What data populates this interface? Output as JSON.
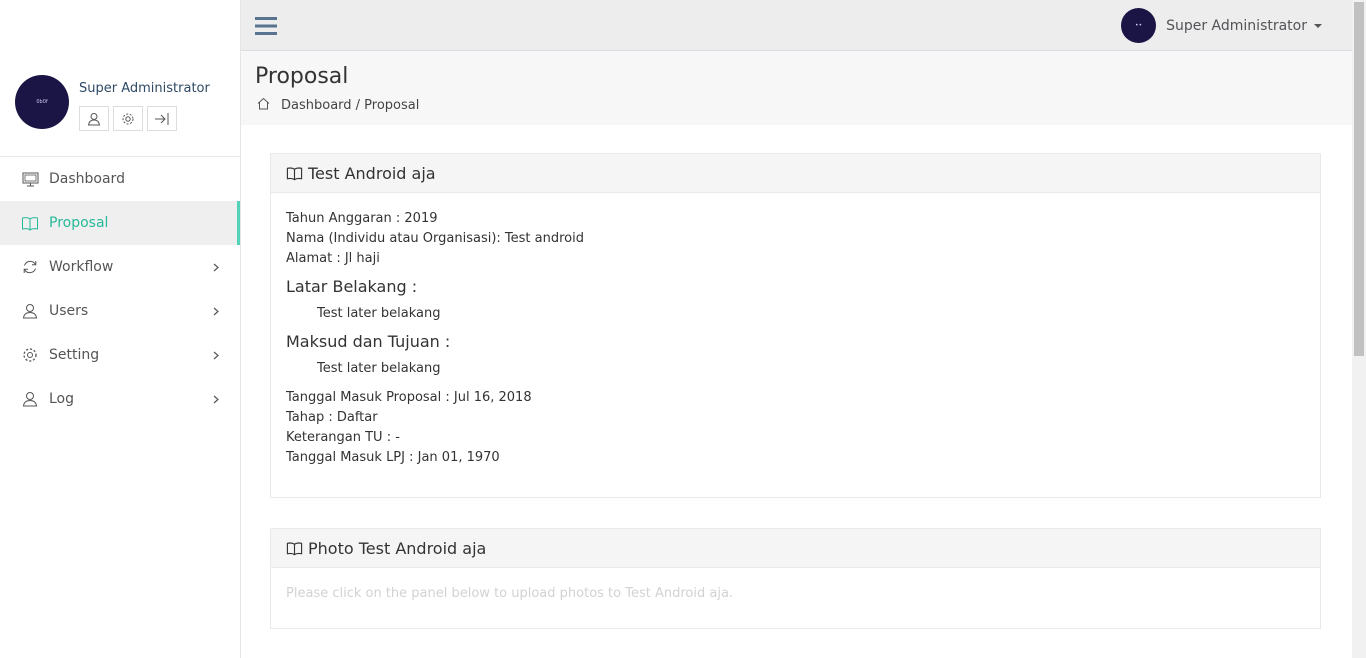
{
  "topbar": {
    "user_name": "Super Administrator",
    "avatar_text": "••"
  },
  "sidebar": {
    "profile": {
      "name": "Super Administrator",
      "avatar_text": "0b0f"
    },
    "items": [
      {
        "label": "Dashboard",
        "icon": "monitor-icon"
      },
      {
        "label": "Proposal",
        "icon": "book-icon",
        "active": true
      },
      {
        "label": "Workflow",
        "icon": "refresh-icon"
      },
      {
        "label": "Users",
        "icon": "user-icon"
      },
      {
        "label": "Setting",
        "icon": "gear-icon"
      },
      {
        "label": "Log",
        "icon": "user-icon"
      }
    ]
  },
  "page": {
    "title": "Proposal",
    "breadcrumb": "Dashboard / Proposal"
  },
  "detail_panel": {
    "title": "Test Android aja",
    "tahun_anggaran": "Tahun Anggaran : 2019",
    "nama": "Nama (Individu atau Organisasi): Test android",
    "alamat": "Alamat : Jl haji",
    "latar_heading": "Latar Belakang :",
    "latar_text": "Test later belakang",
    "maksud_heading": "Maksud dan Tujuan :",
    "maksud_text": "Test later belakang",
    "tanggal_masuk": "Tanggal Masuk Proposal : Jul 16, 2018",
    "tahap": "Tahap : Daftar",
    "keterangan": "Keterangan TU : -",
    "tanggal_lpj": "Tanggal Masuk LPJ : Jan 01, 1970"
  },
  "photo_panel": {
    "title": "Photo Test Android aja",
    "hint": "Please click on the panel below to upload photos to Test Android aja."
  },
  "colors": {
    "accent": "#26b99a",
    "avatar": "#1b1545"
  }
}
